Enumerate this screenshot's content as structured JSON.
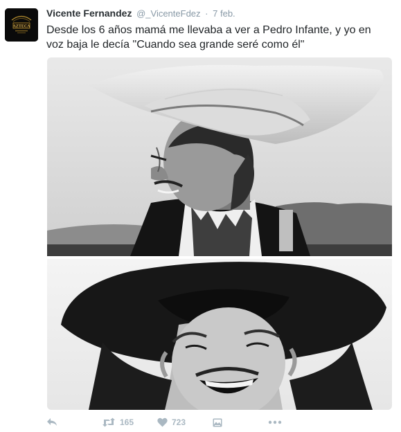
{
  "tweet": {
    "author_name": "Vicente Fernandez",
    "author_handle": "@_VicenteFdez",
    "separator": "·",
    "date": "7 feb.",
    "text": "Desde los 6 años mamá me llevaba a ver a Pedro Infante, y yo en voz baja le decía \"Cuando sea grande seré como él\"",
    "avatar_logo_text": "AZTECA"
  },
  "actions": {
    "reply_icon": "reply-icon",
    "retweet_icon": "retweet-icon",
    "retweet_count": "165",
    "like_icon": "heart-icon",
    "like_count": "723",
    "media_icon": "media-icon",
    "more_icon": "more-dots-icon"
  },
  "colors": {
    "name": "#292f33",
    "meta": "#8899a6",
    "text": "#1f2326",
    "action_icons": "#aab8c2"
  }
}
